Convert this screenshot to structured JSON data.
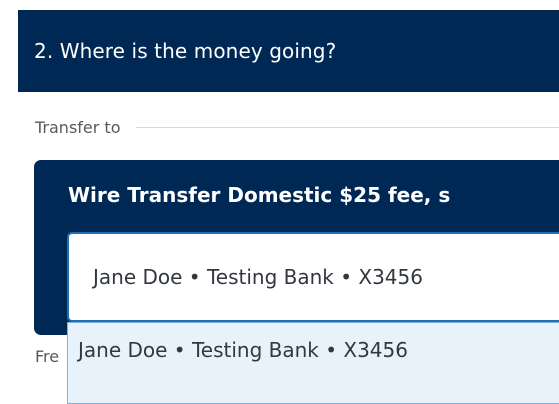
{
  "section": {
    "title": "2. Where is the money going?"
  },
  "transfer_to": {
    "label": "Transfer to"
  },
  "transfer_card": {
    "title": "Wire Transfer Domestic $25 fee, s"
  },
  "recipient_select": {
    "value": "Jane Doe • Testing Bank • X3456"
  },
  "dropdown": {
    "options": [
      {
        "label": "Jane Doe • Testing Bank • X3456"
      }
    ]
  },
  "next_field": {
    "label_partial": "Fre"
  },
  "colors": {
    "navy": "#002855",
    "select_border": "#1f6fb5",
    "option_highlight": "#e8f2fb"
  }
}
